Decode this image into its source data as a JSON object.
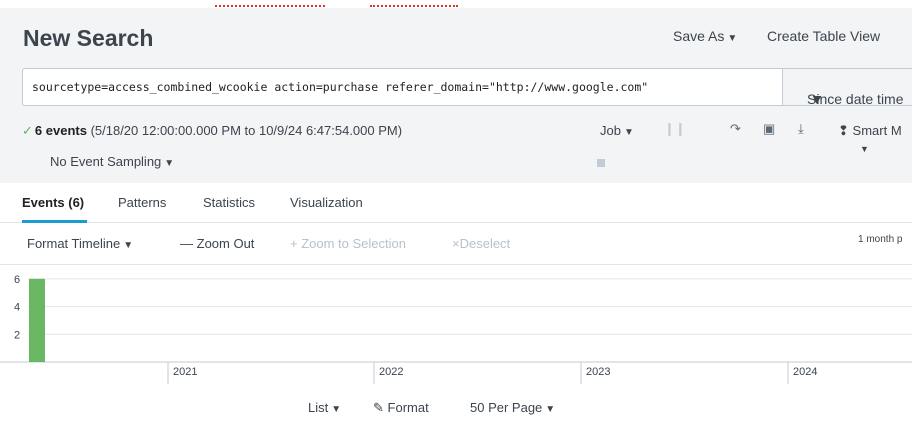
{
  "app": {
    "title": "New Search",
    "save_as_label": "Save As",
    "create_table_view_label": "Create Table View"
  },
  "search": {
    "query": "sourcetype=access_combined_wcookie action=purchase referer_domain=\"http://www.google.com\"",
    "time_range_label": "Since date time"
  },
  "status": {
    "count_label": "6 events",
    "range_text": " (5/18/20 12:00:00.000 PM to 10/9/24 6:47:54.000 PM)",
    "sampling_label": "No Event Sampling"
  },
  "job": {
    "job_label": "Job",
    "mode_label": "Smart M"
  },
  "tabs": [
    {
      "label": "Events (6)",
      "active": true
    },
    {
      "label": "Patterns",
      "active": false
    },
    {
      "label": "Statistics",
      "active": false
    },
    {
      "label": "Visualization",
      "active": false
    }
  ],
  "timeline_controls": {
    "format_timeline_label": "Format Timeline",
    "zoom_out_label": "Zoom Out",
    "zoom_to_selection_label": "+ Zoom to Selection",
    "deselect_label": "Deselect",
    "scale_label": "1 month p"
  },
  "chart_data": {
    "type": "bar",
    "x_axis_ticks": [
      "2021",
      "2022",
      "2023",
      "2024"
    ],
    "y_axis_ticks": [
      6,
      4,
      2
    ],
    "ylim": [
      0,
      7
    ],
    "series": [
      {
        "period_start": "2020-05",
        "value": 6
      }
    ],
    "bar_color": "#6ab763"
  },
  "footer": {
    "list_label": "List",
    "format_label": "Format",
    "per_page_label": "50 Per Page"
  },
  "colors": {
    "accent": "#1a9ccf",
    "success": "#5cb85c",
    "header_bg": "#f2f4f5"
  }
}
